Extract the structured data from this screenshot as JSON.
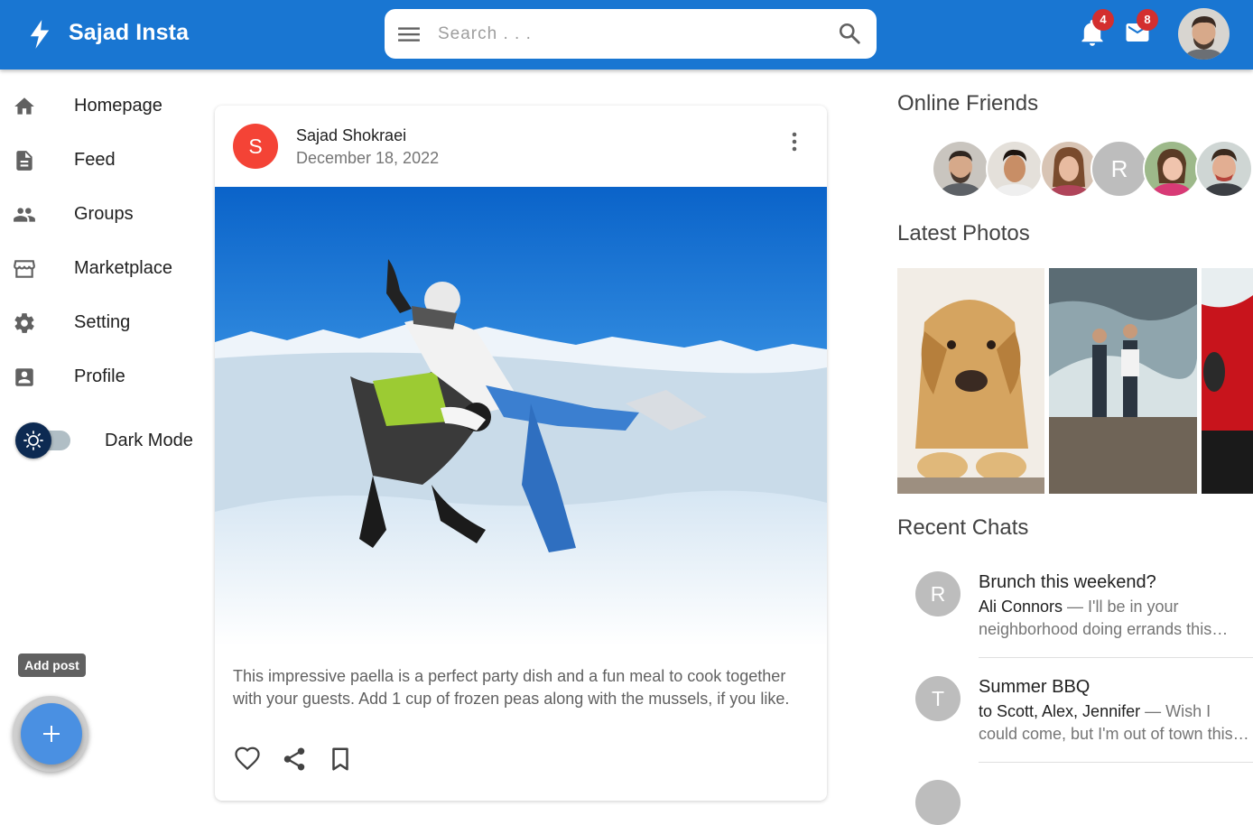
{
  "app": {
    "title": "Sajad Insta",
    "accent": "#1976d2"
  },
  "search": {
    "placeholder": "Search . . ."
  },
  "header": {
    "notifications_count": "4",
    "messages_count": "8"
  },
  "sidebar": {
    "items": [
      {
        "label": "Homepage",
        "icon": "home-icon"
      },
      {
        "label": "Feed",
        "icon": "article-icon"
      },
      {
        "label": "Groups",
        "icon": "group-icon"
      },
      {
        "label": "Marketplace",
        "icon": "storefront-icon"
      },
      {
        "label": "Setting",
        "icon": "settings-icon"
      },
      {
        "label": "Profile",
        "icon": "account-box-icon"
      }
    ],
    "dark_mode_label": "Dark Mode",
    "dark_mode_on": false
  },
  "fab": {
    "tooltip": "Add post"
  },
  "post": {
    "avatar_letter": "S",
    "author": "Sajad Shokraei",
    "date": "December 18, 2022",
    "text": "This impressive paella is a perfect party dish and a fun meal to cook together with your guests. Add 1 cup of frozen peas along with the mussels, if you like."
  },
  "right": {
    "online_friends_title": "Online Friends",
    "friends_letter": "R",
    "latest_photos_title": "Latest Photos",
    "recent_chats_title": "Recent Chats",
    "chats": [
      {
        "avatar": "R",
        "title": "Brunch this weekend?",
        "who": "Ali Connors",
        "snippet": " — I'll be in your neighborhood doing errands this…"
      },
      {
        "avatar": "T",
        "title": "Summer BBQ",
        "who": "to Scott, Alex, Jennifer",
        "snippet": " — Wish I could come, but I'm out of town this…"
      }
    ]
  }
}
